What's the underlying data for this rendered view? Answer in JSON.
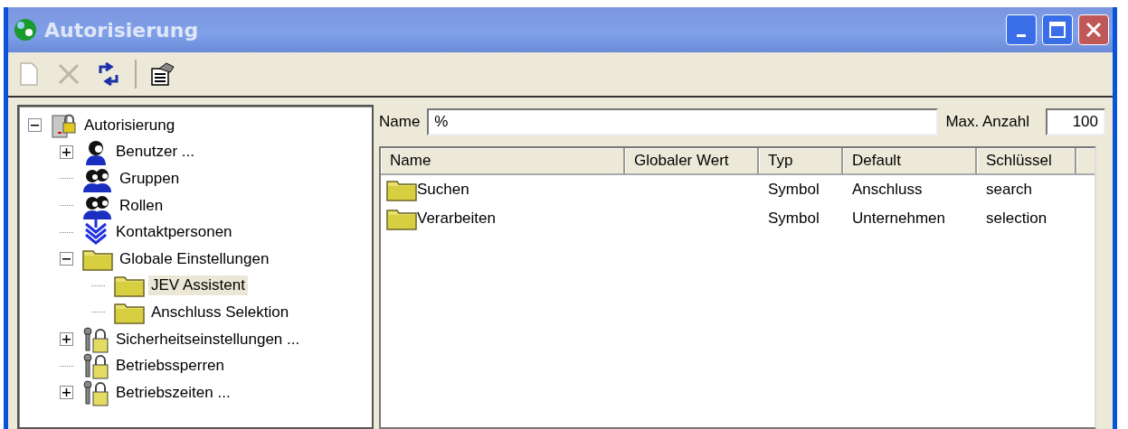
{
  "window": {
    "title": "Autorisierung"
  },
  "toolbar": [
    {
      "kind": "new",
      "disabled": true
    },
    {
      "kind": "delete",
      "disabled": true
    },
    {
      "kind": "refresh",
      "disabled": false
    },
    {
      "kind": "separator"
    },
    {
      "kind": "properties",
      "disabled": false
    }
  ],
  "tree": [
    {
      "label": "Autorisierung",
      "kind": "server-lock",
      "expanded": true,
      "selected": false,
      "children": [
        {
          "label": "Benutzer ...",
          "kind": "user",
          "expanded": false,
          "selected": false
        },
        {
          "label": "Gruppen",
          "kind": "group",
          "selected": false
        },
        {
          "label": "Rollen",
          "kind": "group",
          "selected": false
        },
        {
          "label": "Kontaktpersonen",
          "kind": "contact",
          "selected": false
        },
        {
          "label": "Globale Einstellungen",
          "kind": "folder",
          "expanded": true,
          "selected": false,
          "children": [
            {
              "label": "JEV Assistent",
              "kind": "folder",
              "selected": true
            },
            {
              "label": "Anschluss Selektion",
              "kind": "folder",
              "selected": false
            }
          ]
        },
        {
          "label": "Sicherheitseinstellungen ...",
          "kind": "keys-lock",
          "expanded": false,
          "selected": false
        },
        {
          "label": "Betriebssperren",
          "kind": "keys-lock",
          "selected": false
        },
        {
          "label": "Betriebszeiten ...",
          "kind": "keys-lock",
          "expanded": false,
          "selected": false
        }
      ]
    }
  ],
  "filter": {
    "name_label": "Name",
    "name_value": "%",
    "max_label": "Max. Anzahl",
    "max_value": "100"
  },
  "table": {
    "columns": [
      "Name",
      "Globaler Wert",
      "Typ",
      "Default",
      "Schlüssel"
    ],
    "rows": [
      {
        "kind": "folder",
        "cells": [
          "Suchen",
          "",
          "Symbol",
          "Anschluss",
          "search"
        ]
      },
      {
        "kind": "folder",
        "cells": [
          "Verarbeiten",
          "",
          "Symbol",
          "Unternehmen",
          "selection"
        ]
      }
    ]
  }
}
